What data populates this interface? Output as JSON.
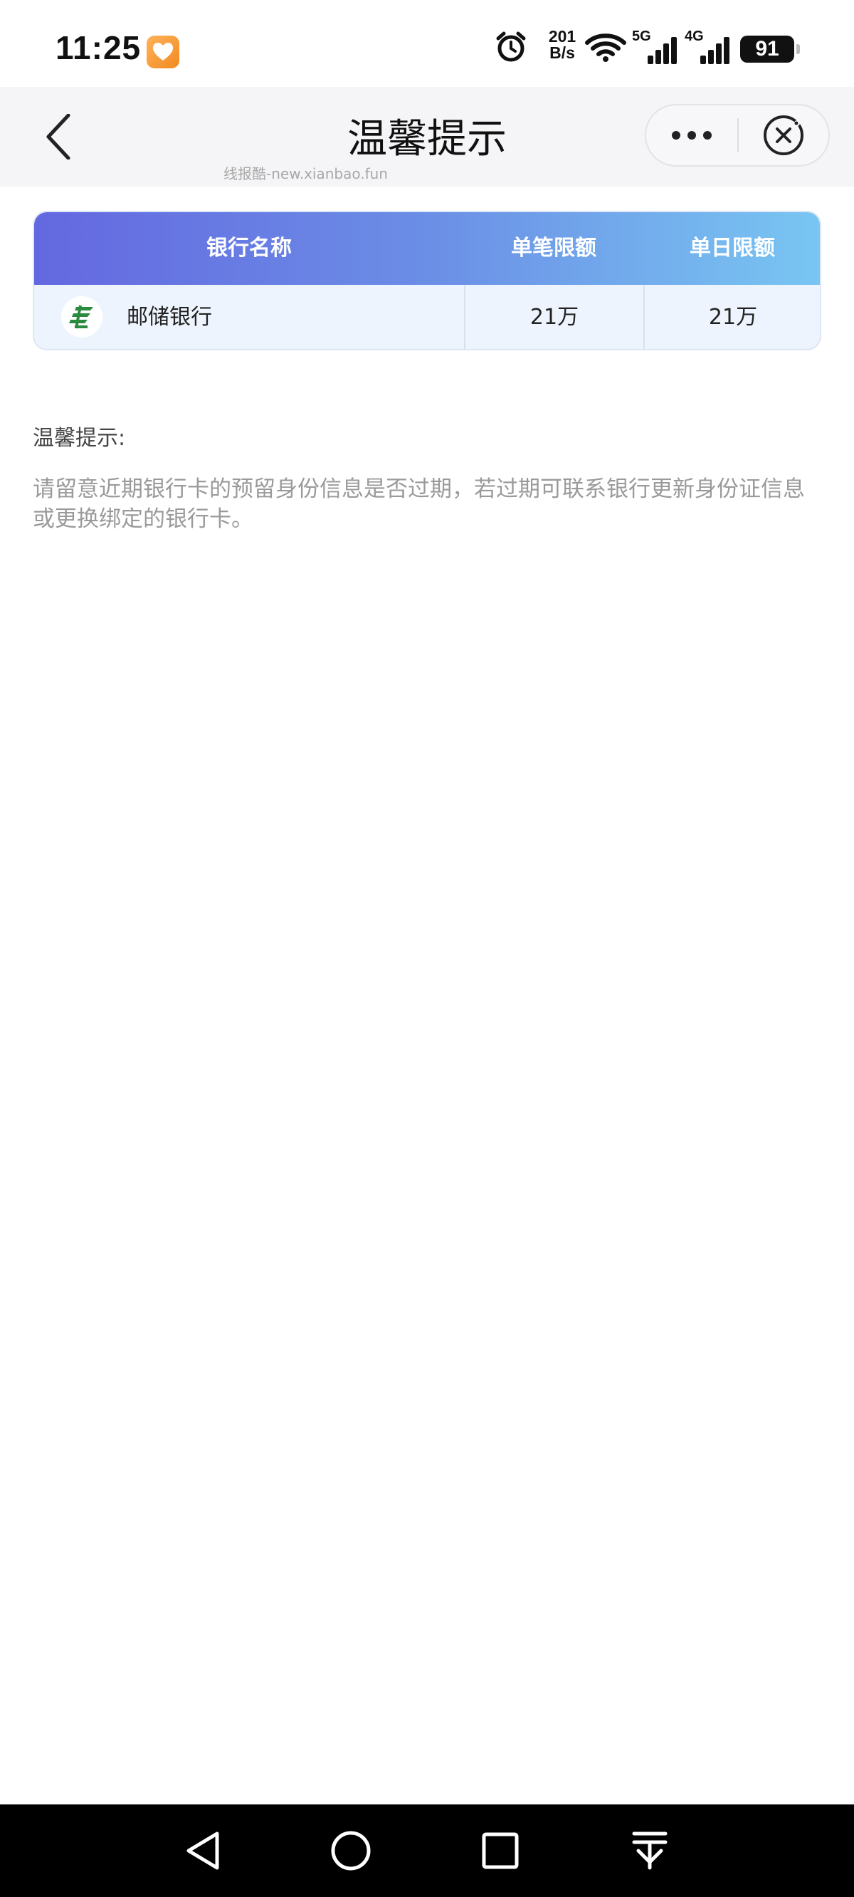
{
  "status_bar": {
    "time": "11:25",
    "net_speed_value": "201",
    "net_speed_unit": "B/s",
    "sig_5g": "5G",
    "sig_4g": "4G",
    "battery": "91"
  },
  "nav": {
    "title": "温馨提示",
    "watermark": "线报酷-new.xianbao.fun"
  },
  "table": {
    "headers": [
      "银行名称",
      "单笔限额",
      "单日限额"
    ],
    "rows": [
      {
        "bank": "邮储银行",
        "single_limit": "21万",
        "daily_limit": "21万"
      }
    ],
    "colors": {
      "header_gradient_start": "#6468e0",
      "header_gradient_end": "#79c6f2",
      "row_bg": "#eef4fd",
      "bank_logo": "#2a8a3e"
    }
  },
  "tip": {
    "heading": "温馨提示:",
    "body": "请留意近期银行卡的预留身份信息是否过期，若过期可联系银行更新身份证信息或更换绑定的银行卡。"
  },
  "icons": {
    "back": "chevron-left-icon",
    "more": "more-dots-icon",
    "close": "close-circle-icon",
    "sys_back": "triangle-back-icon",
    "sys_home": "circle-home-icon",
    "sys_recent": "square-recent-icon",
    "sys_pull": "pull-down-icon"
  }
}
